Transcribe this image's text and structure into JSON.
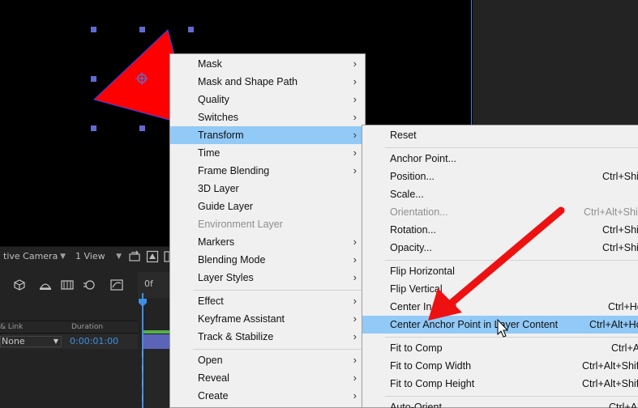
{
  "viewer": {
    "camera_label": "tive Camera",
    "view_label": "1 View",
    "shape_fill": "#ff0000",
    "handle_color": "#5f6bd0"
  },
  "timeline": {
    "ruler_text": "0f",
    "col_link": "& Link",
    "col_duration": "Duration",
    "parent_value": "None",
    "duration_value": "0:00:01:00"
  },
  "main_menu": {
    "items": [
      {
        "label": "Mask",
        "submenu": true
      },
      {
        "label": "Mask and Shape Path",
        "submenu": true
      },
      {
        "label": "Quality",
        "submenu": true
      },
      {
        "label": "Switches",
        "submenu": true
      },
      {
        "label": "Transform",
        "submenu": true,
        "active": true
      },
      {
        "label": "Time",
        "submenu": true
      },
      {
        "label": "Frame Blending",
        "submenu": true
      },
      {
        "label": "3D Layer"
      },
      {
        "label": "Guide Layer"
      },
      {
        "label": "Environment Layer",
        "disabled": true
      },
      {
        "label": "Markers",
        "submenu": true
      },
      {
        "label": "Blending Mode",
        "submenu": true
      },
      {
        "label": "Layer Styles",
        "submenu": true
      },
      {
        "label": "Effect",
        "submenu": true
      },
      {
        "label": "Keyframe Assistant",
        "submenu": true
      },
      {
        "label": "Track & Stabilize",
        "submenu": true
      },
      {
        "label": "Open",
        "submenu": true
      },
      {
        "label": "Reveal",
        "submenu": true
      },
      {
        "label": "Create",
        "submenu": true
      }
    ]
  },
  "transform_menu": {
    "items": [
      {
        "label": "Reset",
        "shortcut": ""
      },
      {
        "label": "Anchor Point...",
        "shortcut": ""
      },
      {
        "label": "Position...",
        "shortcut": "Ctrl+Shif"
      },
      {
        "label": "Scale...",
        "shortcut": ""
      },
      {
        "label": "Orientation...",
        "shortcut": "Ctrl+Alt+Shif",
        "disabled": true
      },
      {
        "label": "Rotation...",
        "shortcut": "Ctrl+Shif"
      },
      {
        "label": "Opacity...",
        "shortcut": "Ctrl+Shif"
      },
      {
        "label": "Flip Horizontal",
        "shortcut": ""
      },
      {
        "label": "Flip Vertical",
        "shortcut": ""
      },
      {
        "label": "Center In View",
        "shortcut": "Ctrl+Ho"
      },
      {
        "label": "Center Anchor Point in Layer Content",
        "shortcut": "Ctrl+Alt+Ho",
        "active": true
      },
      {
        "label": "Fit to Comp",
        "shortcut": "Ctrl+A"
      },
      {
        "label": "Fit to Comp Width",
        "shortcut": "Ctrl+Alt+Shif"
      },
      {
        "label": "Fit to Comp Height",
        "shortcut": "Ctrl+Alt+Shif"
      },
      {
        "label": "Auto-Orient...",
        "shortcut": "Ctrl+Alt+"
      }
    ]
  },
  "annotation": {
    "arrow_color": "#ee1111"
  }
}
